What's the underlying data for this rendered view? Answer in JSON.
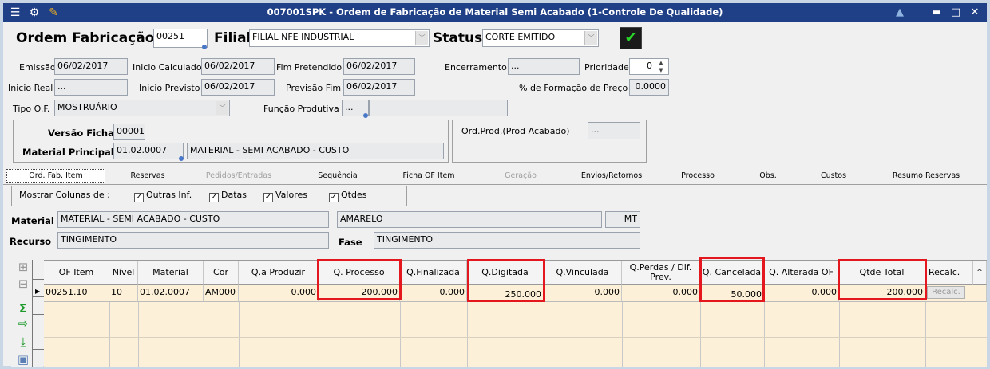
{
  "window": {
    "title": "007001SPK - Ordem de Fabricação de Material Semi Acabado (1-Controle De Qualidade)"
  },
  "header": {
    "ordem_label": "Ordem Fabricação",
    "ordem_value": "00251",
    "filial_label": "Filial",
    "filial_value": "FILIAL NFE INDUSTRIAL",
    "status_label": "Status",
    "status_value": "CORTE EMITIDO"
  },
  "form": {
    "emissao_label": "Emissão",
    "emissao_value": "06/02/2017",
    "inicio_calc_label": "Inicio Calculado",
    "inicio_calc_value": "06/02/2017",
    "fim_pret_label": "Fim Pretendido",
    "fim_pret_value": "06/02/2017",
    "encerramento_label": "Encerramento",
    "encerramento_value": "...",
    "prioridade_label": "Prioridade",
    "prioridade_value": "0",
    "inicio_real_label": "Inicio Real",
    "inicio_real_value": "...",
    "inicio_prev_label": "Inicio Previsto",
    "inicio_prev_value": "06/02/2017",
    "prev_fim_label": "Previsão Fim",
    "prev_fim_value": "06/02/2017",
    "formacao_label": "% de Formação de Preço",
    "formacao_value": "0.0000",
    "tipo_of_label": "Tipo O.F.",
    "tipo_of_value": "MOSTRUÁRIO",
    "funcao_label": "Função Produtiva",
    "funcao_value": "...",
    "versao_label": "Versão Ficha",
    "versao_value": "00001",
    "material_princ_label": "Material Principal",
    "material_princ_code": "01.02.0007",
    "material_princ_desc": "MATERIAL - SEMI ACABADO - CUSTO",
    "ord_prod_label": "Ord.Prod.(Prod Acabado)",
    "ord_prod_value": "..."
  },
  "tabs": [
    "Ord. Fab. Item",
    "Reservas",
    "Pedidos/Entradas",
    "Sequência",
    "Ficha OF Item",
    "Geração",
    "Envios/Retornos",
    "Processo",
    "Obs.",
    "Custos",
    "Resumo Reservas"
  ],
  "filters": {
    "mostrar_label": "Mostrar Colunas de :",
    "outras": "Outras Inf.",
    "datas": "Datas",
    "valores": "Valores",
    "qtdes": "Qtdes"
  },
  "item": {
    "material_label": "Material",
    "material_value": "MATERIAL - SEMI ACABADO - CUSTO",
    "cor_value": "AMARELO",
    "unidade_value": "MT",
    "recurso_label": "Recurso",
    "recurso_value": "TINGIMENTO",
    "fase_label": "Fase",
    "fase_value": "TINGIMENTO"
  },
  "grid": {
    "headers": [
      "OF Item",
      "Nível",
      "Material",
      "Cor",
      "Q.a Produzir",
      "Q. Processo",
      "Q.Finalizada",
      "Q.Digitada",
      "Q.Vinculada",
      "Q.Perdas / Dif. Prev.",
      "Q. Cancelada",
      "Q. Alterada OF",
      "Qtde Total",
      "Recalc."
    ],
    "row": [
      "00251.10",
      "10",
      "01.02.0007",
      "AM000",
      "0.000",
      "200.000",
      "0.000",
      "250.000",
      "0.000",
      "0.000",
      "50.000",
      "0.000",
      "200.000",
      "Recalc."
    ]
  },
  "colors": {
    "titlebar": "#1f3f86",
    "highlight": "#e4161e",
    "row_bg": "#fcf1d8"
  }
}
